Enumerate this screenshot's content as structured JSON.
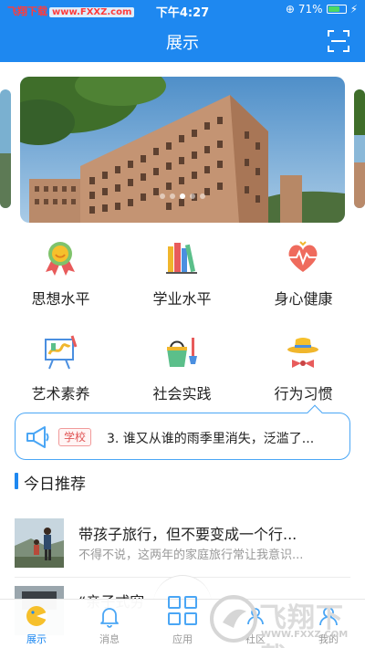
{
  "status_bar": {
    "brand": "飞翔下载",
    "url": "www.FXXZ.com",
    "time": "下午4:27",
    "battery": "71%",
    "battery_level": 0.71
  },
  "nav": {
    "title": "展示",
    "right_icon": "scan-icon"
  },
  "banner": {
    "dot_count": 5,
    "active_dot": 2
  },
  "categories": [
    {
      "label": "思想水平",
      "icon": "medal-icon"
    },
    {
      "label": "学业水平",
      "icon": "books-icon"
    },
    {
      "label": "身心健康",
      "icon": "heart-pulse-icon"
    },
    {
      "label": "艺术素养",
      "icon": "easel-icon"
    },
    {
      "label": "社会实践",
      "icon": "bucket-shovel-icon"
    },
    {
      "label": "行为习惯",
      "icon": "hat-bowtie-icon"
    }
  ],
  "notice": {
    "tag": "学校",
    "text": "3. 谁又从谁的雨季里消失，泛滥了..."
  },
  "section": {
    "title": "今日推荐"
  },
  "articles": [
    {
      "title": "带孩子旅行，但不要变成一个行...",
      "subtitle": "不得不说，这两年的家庭旅行常让我意识..."
    },
    {
      "title": "“亲子式穷",
      "subtitle": ""
    }
  ],
  "tabs": [
    {
      "label": "展示",
      "icon": "pie-chart-icon",
      "active": true
    },
    {
      "label": "消息",
      "icon": "bell-icon",
      "active": false
    },
    {
      "label": "应用",
      "icon": "apps-grid-icon",
      "active": false
    },
    {
      "label": "社区",
      "icon": "community-icon",
      "active": false
    },
    {
      "label": "我的",
      "icon": "user-icon",
      "active": false
    }
  ],
  "watermark": {
    "text": "飞翔下载",
    "url": "WWW.FXXZ.COM"
  },
  "colors": {
    "primary": "#1e88f0",
    "tag_red": "#e05555",
    "text": "#222222",
    "muted": "#999999"
  }
}
